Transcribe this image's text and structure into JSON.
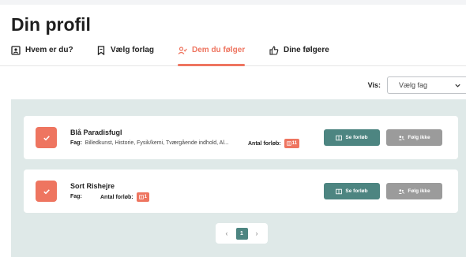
{
  "page": {
    "title": "Din profil"
  },
  "tabs": [
    {
      "label": "Hvem er du?",
      "icon": "person-card-icon",
      "active": false
    },
    {
      "label": "Vælg forlag",
      "icon": "bookmark-icon",
      "active": false
    },
    {
      "label": "Dem du følger",
      "icon": "user-check-icon",
      "active": true
    },
    {
      "label": "Dine følgere",
      "icon": "thumbs-up-icon",
      "active": false
    }
  ],
  "filter": {
    "label": "Vis:",
    "selected": "Vælg fag"
  },
  "cards": [
    {
      "name": "Blå Paradisfugl",
      "subjects_label": "Fag:",
      "subjects": "Billedkunst, Historie, Fysik/kemi, Tværgående indhold, Al...",
      "count_label": "Antal forløb:",
      "count": "11",
      "see_label": "Se forløb",
      "unfollow_label": "Følg ikke"
    },
    {
      "name": "Sort Rishejre",
      "subjects_label": "Fag:",
      "subjects": "",
      "count_label": "Antal forløb:",
      "count": "1",
      "see_label": "Se forløb",
      "unfollow_label": "Følg ikke"
    }
  ],
  "pagination": {
    "prev": "‹",
    "current": "1",
    "next": "›"
  },
  "colors": {
    "accent": "#ee7560",
    "teal": "#4d8581",
    "gray_button": "#9b9b9b",
    "panel_bg": "#dfe9e8"
  }
}
